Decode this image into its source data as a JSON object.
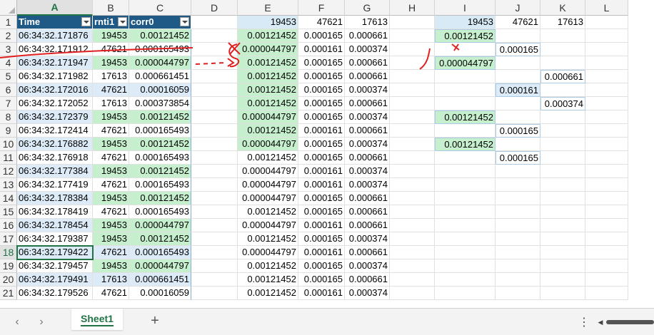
{
  "columns": [
    "A",
    "B",
    "C",
    "D",
    "E",
    "F",
    "G",
    "H",
    "I",
    "J",
    "K",
    "L"
  ],
  "rows": [
    "1",
    "2",
    "3",
    "4",
    "5",
    "6",
    "7",
    "8",
    "9",
    "10",
    "11",
    "12",
    "13",
    "14",
    "15",
    "16",
    "17",
    "18",
    "19",
    "20",
    "21"
  ],
  "table": {
    "headers": [
      "Time",
      "rnti1",
      "corr0"
    ],
    "rows": [
      [
        "06:34:32.171876",
        "19453",
        "0.00121452"
      ],
      [
        "06:34:32.171912",
        "47621",
        "0.000165493"
      ],
      [
        "06:34:32.171947",
        "19453",
        "0.000044797"
      ],
      [
        "06:34:32.171982",
        "17613",
        "0.000661451"
      ],
      [
        "06:34:32.172016",
        "47621",
        "0.00016059"
      ],
      [
        "06:34:32.172052",
        "17613",
        "0.000373854"
      ],
      [
        "06:34:32.172379",
        "19453",
        "0.00121452"
      ],
      [
        "06:34:32.172414",
        "47621",
        "0.000165493"
      ],
      [
        "06:34:32.176882",
        "19453",
        "0.00121452"
      ],
      [
        "06:34:32.176918",
        "47621",
        "0.000165493"
      ],
      [
        "06:34:32.177384",
        "19453",
        "0.00121452"
      ],
      [
        "06:34:32.177419",
        "47621",
        "0.000165493"
      ],
      [
        "06:34:32.178384",
        "19453",
        "0.00121452"
      ],
      [
        "06:34:32.178419",
        "47621",
        "0.000165493"
      ],
      [
        "06:34:32.178454",
        "19453",
        "0.000044797"
      ],
      [
        "06:34:32.179387",
        "19453",
        "0.00121452"
      ],
      [
        "06:34:32.179422",
        "47621",
        "0.000165493"
      ],
      [
        "06:34:32.179457",
        "19453",
        "0.000044797"
      ],
      [
        "06:34:32.179491",
        "17613",
        "0.000661451"
      ],
      [
        "06:34:32.179526",
        "47621",
        "0.00016059"
      ]
    ]
  },
  "efg": {
    "headers": [
      "19453",
      "47621",
      "17613"
    ],
    "rows": [
      [
        "0.00121452",
        "0.000165",
        "0.000661"
      ],
      [
        "0.000044797",
        "0.000161",
        "0.000374"
      ],
      [
        "0.00121452",
        "0.000165",
        "0.000661"
      ],
      [
        "0.00121452",
        "0.000165",
        "0.000661"
      ],
      [
        "0.00121452",
        "0.000165",
        "0.000374"
      ],
      [
        "0.00121452",
        "0.000165",
        "0.000661"
      ],
      [
        "0.000044797",
        "0.000165",
        "0.000374"
      ],
      [
        "0.00121452",
        "0.000161",
        "0.000661"
      ],
      [
        "0.000044797",
        "0.000165",
        "0.000374"
      ],
      [
        "0.00121452",
        "0.000165",
        "0.000661"
      ],
      [
        "0.000044797",
        "0.000161",
        "0.000374"
      ],
      [
        "0.000044797",
        "0.000161",
        "0.000374"
      ],
      [
        "0.000044797",
        "0.000165",
        "0.000661"
      ],
      [
        "0.00121452",
        "0.000165",
        "0.000661"
      ],
      [
        "0.000044797",
        "0.000161",
        "0.000661"
      ],
      [
        "0.00121452",
        "0.000165",
        "0.000374"
      ],
      [
        "0.000044797",
        "0.000161",
        "0.000661"
      ],
      [
        "0.00121452",
        "0.000165",
        "0.000374"
      ],
      [
        "0.00121452",
        "0.000165",
        "0.000661"
      ],
      [
        "0.00121452",
        "0.000161",
        "0.000374"
      ]
    ]
  },
  "ijk": {
    "headers": [
      "19453",
      "47621",
      "17613"
    ],
    "cells": [
      {
        "row": 2,
        "col": "I",
        "value": "0.00121452",
        "fill": "green"
      },
      {
        "row": 3,
        "col": "J",
        "value": "0.000165",
        "fill": "none"
      },
      {
        "row": 4,
        "col": "I",
        "value": "0.000044797",
        "fill": "green"
      },
      {
        "row": 5,
        "col": "K",
        "value": "0.000661",
        "fill": "none"
      },
      {
        "row": 6,
        "col": "J",
        "value": "0.000161",
        "fill": "blue"
      },
      {
        "row": 7,
        "col": "K",
        "value": "0.000374",
        "fill": "none"
      },
      {
        "row": 8,
        "col": "I",
        "value": "0.00121452",
        "fill": "green"
      },
      {
        "row": 9,
        "col": "J",
        "value": "0.000165",
        "fill": "none"
      },
      {
        "row": 10,
        "col": "I",
        "value": "0.00121452",
        "fill": "green"
      },
      {
        "row": 11,
        "col": "J",
        "value": "0.000165",
        "fill": "none"
      }
    ]
  },
  "colors": {
    "header_blue": "#1f5a86",
    "band_blue": "#dcebf7",
    "band_green": "#c6efce",
    "excel_green": "#217346",
    "annotation_red": "#e02020"
  },
  "sheet_tabs": [
    "Sheet1"
  ],
  "icons": {
    "prev": "chevron-left-icon",
    "next": "chevron-right-icon",
    "add": "plus-icon",
    "more": "vertical-ellipsis-icon"
  }
}
